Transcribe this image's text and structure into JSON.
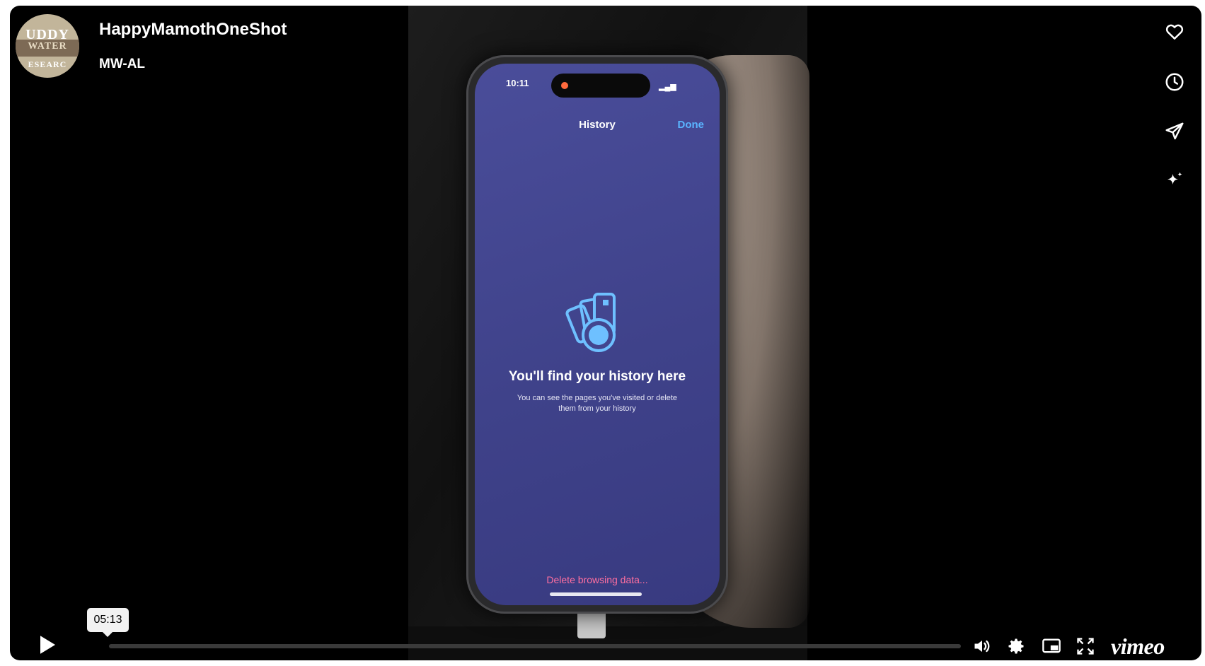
{
  "header": {
    "title": "HappyMamothOneShot",
    "subtitle": "MW-AL",
    "avatar_text": [
      "UDDY",
      "WATER",
      "ESEARC"
    ]
  },
  "side_actions": [
    {
      "icon": "heart-icon",
      "label": "Like"
    },
    {
      "icon": "clock-icon",
      "label": "Watch later"
    },
    {
      "icon": "paper-plane-icon",
      "label": "Share"
    },
    {
      "icon": "sparkle-icon",
      "label": "AI"
    }
  ],
  "video_content": {
    "status_time": "10:11",
    "sheet_title": "History",
    "done_label": "Done",
    "empty_title": "You'll find your history here",
    "empty_desc": "You can see the pages you've visited or delete them from your history",
    "delete_label": "Delete browsing data..."
  },
  "controls": {
    "time_tooltip": "05:13",
    "brand": "vimeo",
    "progress": 0.0
  },
  "colors": {
    "player_bg": "#000000",
    "screen_bg": "#43468f",
    "done_blue": "#5ab4ff",
    "delete_pink": "#ff6fa0"
  }
}
